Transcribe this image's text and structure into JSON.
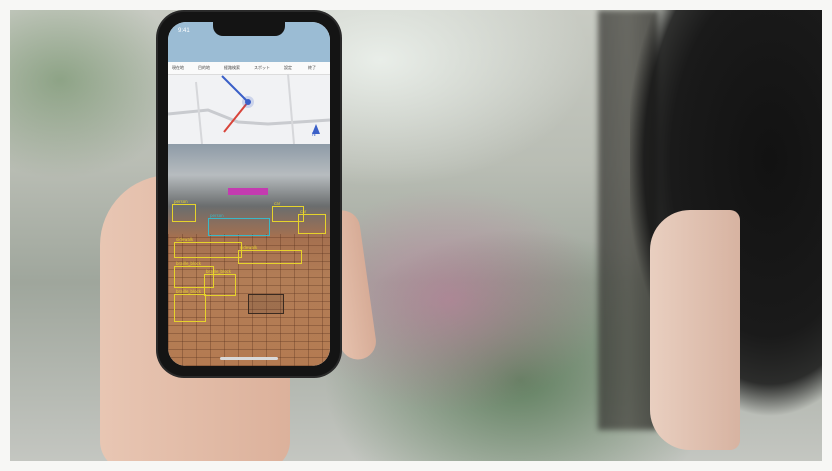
{
  "scene": {
    "accent_detection_yellow": "#e6d32b",
    "accent_detection_cyan": "#39b8c8",
    "accent_detection_magenta": "#c43bb0"
  },
  "phone": {
    "status_time": "9:41",
    "map": {
      "tabs": [
        "現在地",
        "目的地",
        "経路検索",
        "スポット",
        "設定",
        "終了"
      ],
      "compass_label": "N"
    },
    "camera_view": {
      "detections": [
        {
          "label": "person",
          "color": "#e6d32b"
        },
        {
          "label": "car",
          "color": "#e6d32b"
        },
        {
          "label": "car",
          "color": "#e6d32b"
        },
        {
          "label": "person",
          "color": "#39b8c8"
        },
        {
          "label": "sidewalk",
          "color": "#e6d32b"
        },
        {
          "label": "sidewalk",
          "color": "#e6d32b"
        },
        {
          "label": "braille_block",
          "color": "#e6d32b"
        },
        {
          "label": "braille_block",
          "color": "#e6d32b"
        },
        {
          "label": "braille_block",
          "color": "#e6d32b"
        }
      ]
    }
  }
}
